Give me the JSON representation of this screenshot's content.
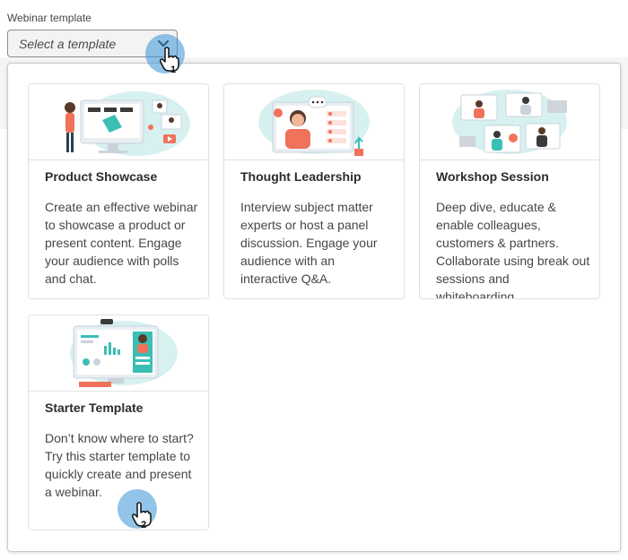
{
  "field": {
    "label": "Webinar template",
    "placeholder": "Select a template"
  },
  "templates": [
    {
      "title": "Product Showcase",
      "description": "Create an effective webinar to showcase a product or present content. Engage your audience with polls and chat.",
      "illustration": "product-showcase-illustration"
    },
    {
      "title": "Thought Leadership",
      "description": "Interview subject matter experts or host a panel discussion. Engage your audience with an interactive Q&A.",
      "illustration": "thought-leadership-illustration"
    },
    {
      "title": "Workshop Session",
      "description": "Deep dive, educate & enable colleagues, customers & partners. Collaborate using break out sessions and whiteboarding.",
      "illustration": "workshop-session-illustration"
    },
    {
      "title": "Starter Template",
      "description": "Don’t know where to start? Try this starter template to quickly create and present a webinar.",
      "illustration": "starter-template-illustration"
    }
  ],
  "steps": [
    {
      "number": "1"
    },
    {
      "number": "2"
    }
  ],
  "colors": {
    "accent": "#3892d6",
    "teal": "#3bbfb5",
    "coral": "#f0725a"
  }
}
